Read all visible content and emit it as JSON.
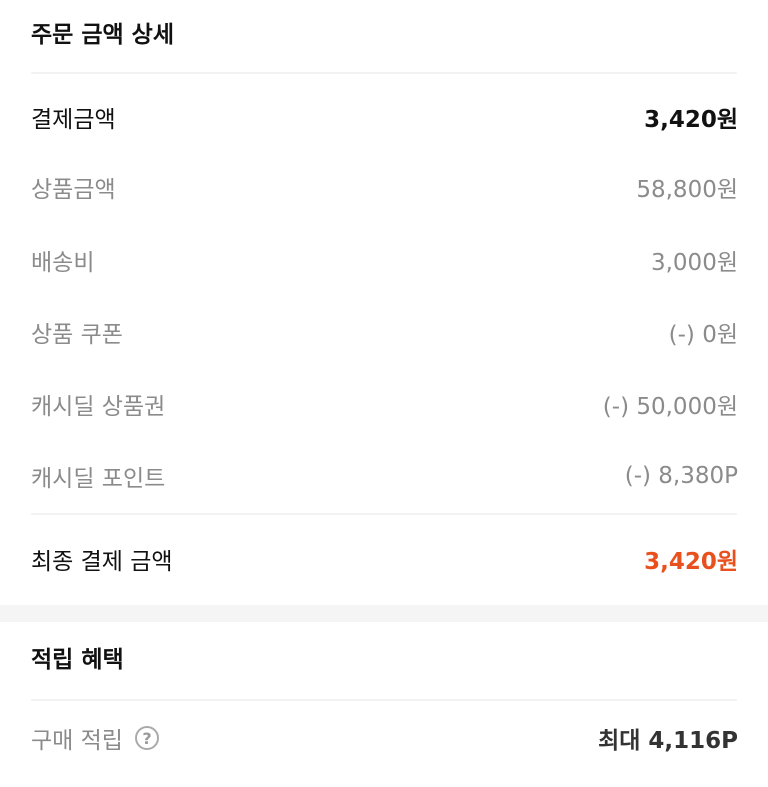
{
  "order_details": {
    "title": "주문 금액 상세",
    "rows": [
      {
        "label": "결제금액",
        "value": "3,420원"
      },
      {
        "label": "상품금액",
        "value": "58,800원"
      },
      {
        "label": "배송비",
        "value": "3,000원"
      },
      {
        "label": "상품 쿠폰",
        "value": "(-) 0원"
      },
      {
        "label": "캐시딜 상품권",
        "value": "(-) 50,000원"
      },
      {
        "label": "캐시딜 포인트",
        "value": "(-) 8,380P"
      }
    ],
    "final": {
      "label": "최종 결제 금액",
      "value": "3,420원"
    }
  },
  "rewards": {
    "title": "적립 혜택",
    "purchase": {
      "label": "구매 적립",
      "help_icon": "?",
      "value": "최대 4,116P"
    }
  },
  "colors": {
    "accent": "#e8501d",
    "muted_text": "#8b8b8b",
    "section_gap": "#f5f5f5"
  },
  "icons": {
    "help": "question-circle-icon"
  }
}
